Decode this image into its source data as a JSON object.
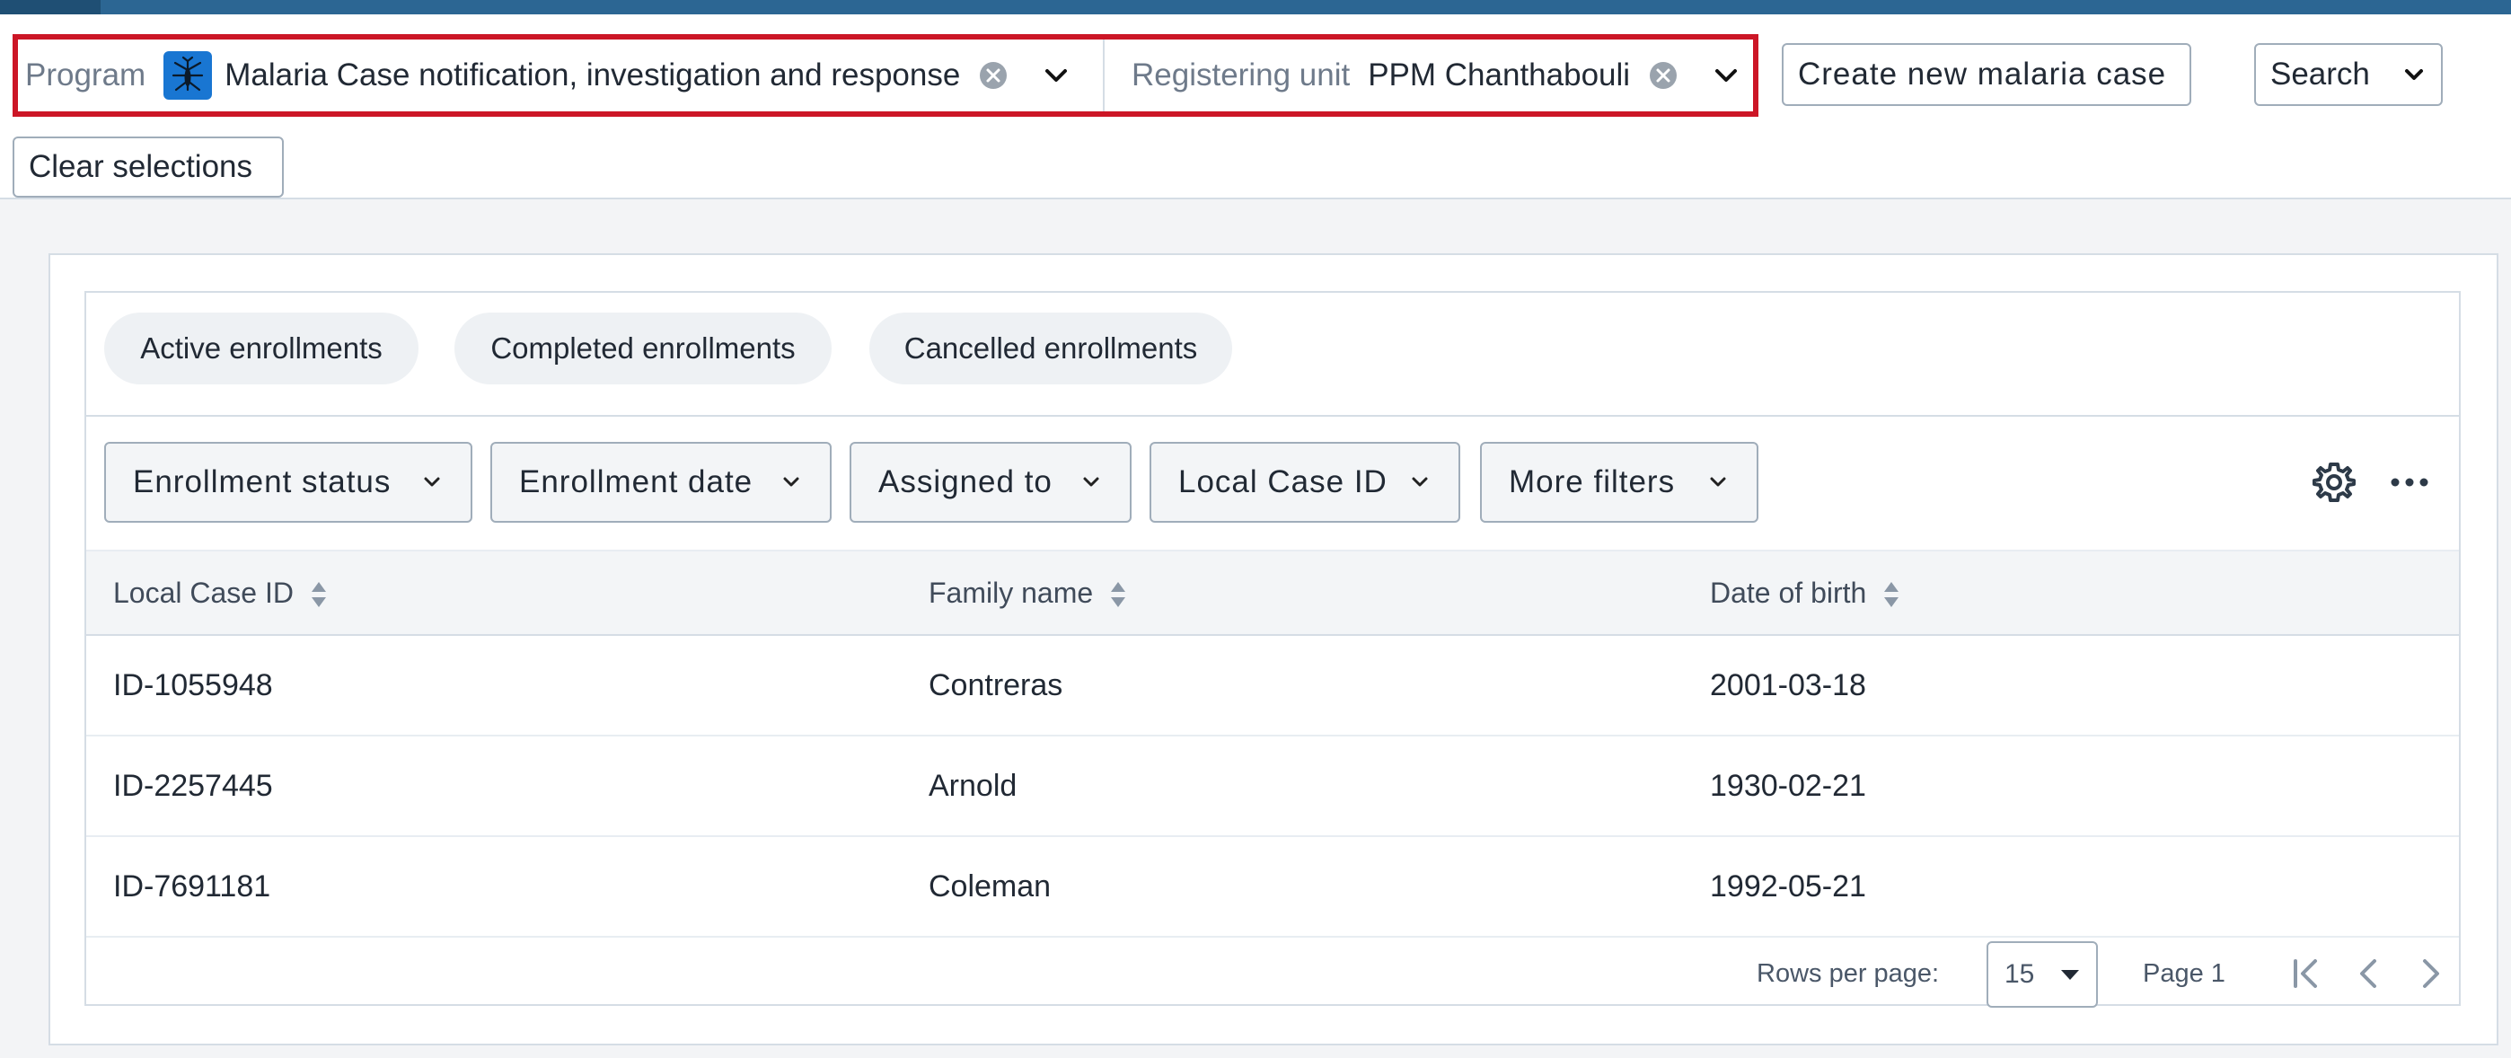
{
  "context": {
    "program_label": "Program",
    "program_value": "Malaria Case notification, investigation and response",
    "program_icon": "mosquito-icon",
    "unit_label": "Registering unit",
    "unit_value": "PPM Chanthabouli",
    "highlight_color": "#cc1626"
  },
  "actions": {
    "create_label": "Create new malaria case",
    "search_label": "Search",
    "clear_label": "Clear selections"
  },
  "segments": [
    "Active enrollments",
    "Completed enrollments",
    "Cancelled enrollments"
  ],
  "filters": [
    "Enrollment status",
    "Enrollment date",
    "Assigned to",
    "Local Case ID",
    "More filters"
  ],
  "table": {
    "columns": [
      "Local Case ID",
      "Family name",
      "Date of birth"
    ],
    "rows": [
      [
        "ID-1055948",
        "Contreras",
        "2001-03-18"
      ],
      [
        "ID-2257445",
        "Arnold",
        "1930-02-21"
      ],
      [
        "ID-7691181",
        "Coleman",
        "1992-05-21"
      ]
    ]
  },
  "pagination": {
    "rows_per_page_label": "Rows per page:",
    "rows_per_page_value": "15",
    "page_label": "Page 1"
  },
  "colors": {
    "header_bar": "#2c6693",
    "accent": "#1976d2"
  }
}
